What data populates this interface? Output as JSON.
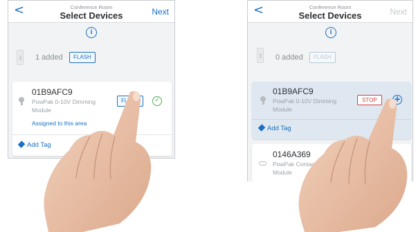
{
  "left": {
    "nav": {
      "back": "<",
      "crumb": "Conference Room",
      "title": "Select Devices",
      "next": "Next"
    },
    "info": "i",
    "added_label": "1 added",
    "flash_label": "FLASH",
    "device": {
      "id": "01B9AFC9",
      "desc_line1": "PowPak 0-10V Dimming",
      "desc_line2": "Module",
      "flash_label": "FLASH",
      "assigned": "Assigned to this area",
      "add_tag": "Add Tag"
    }
  },
  "right": {
    "nav": {
      "back": "<",
      "crumb": "Conference Room",
      "title": "Select Devices",
      "next": "Next"
    },
    "info": "i",
    "added_label": "0 added",
    "flash_label": "FLASH",
    "device": {
      "id": "01B9AFC9",
      "desc_line1": "PowPak 0-10V Dimming",
      "desc_line2": "Module",
      "stop_label": "STOP",
      "add_tag": "Add Tag"
    },
    "device2": {
      "id": "0146A369",
      "desc_line1": "PowPak Contact",
      "desc_line2": "Module"
    }
  },
  "colors": {
    "accent": "#1b6fc2",
    "stop": "#d13f3f",
    "check": "#4caf50",
    "selected_card": "#dfe7f0"
  },
  "icons": [
    "back-chevron-icon",
    "info-icon",
    "switch-icon",
    "bulb-icon",
    "check-circle-icon",
    "plus-circle-icon",
    "tag-icon",
    "contact-module-icon",
    "pointing-hand-image"
  ]
}
